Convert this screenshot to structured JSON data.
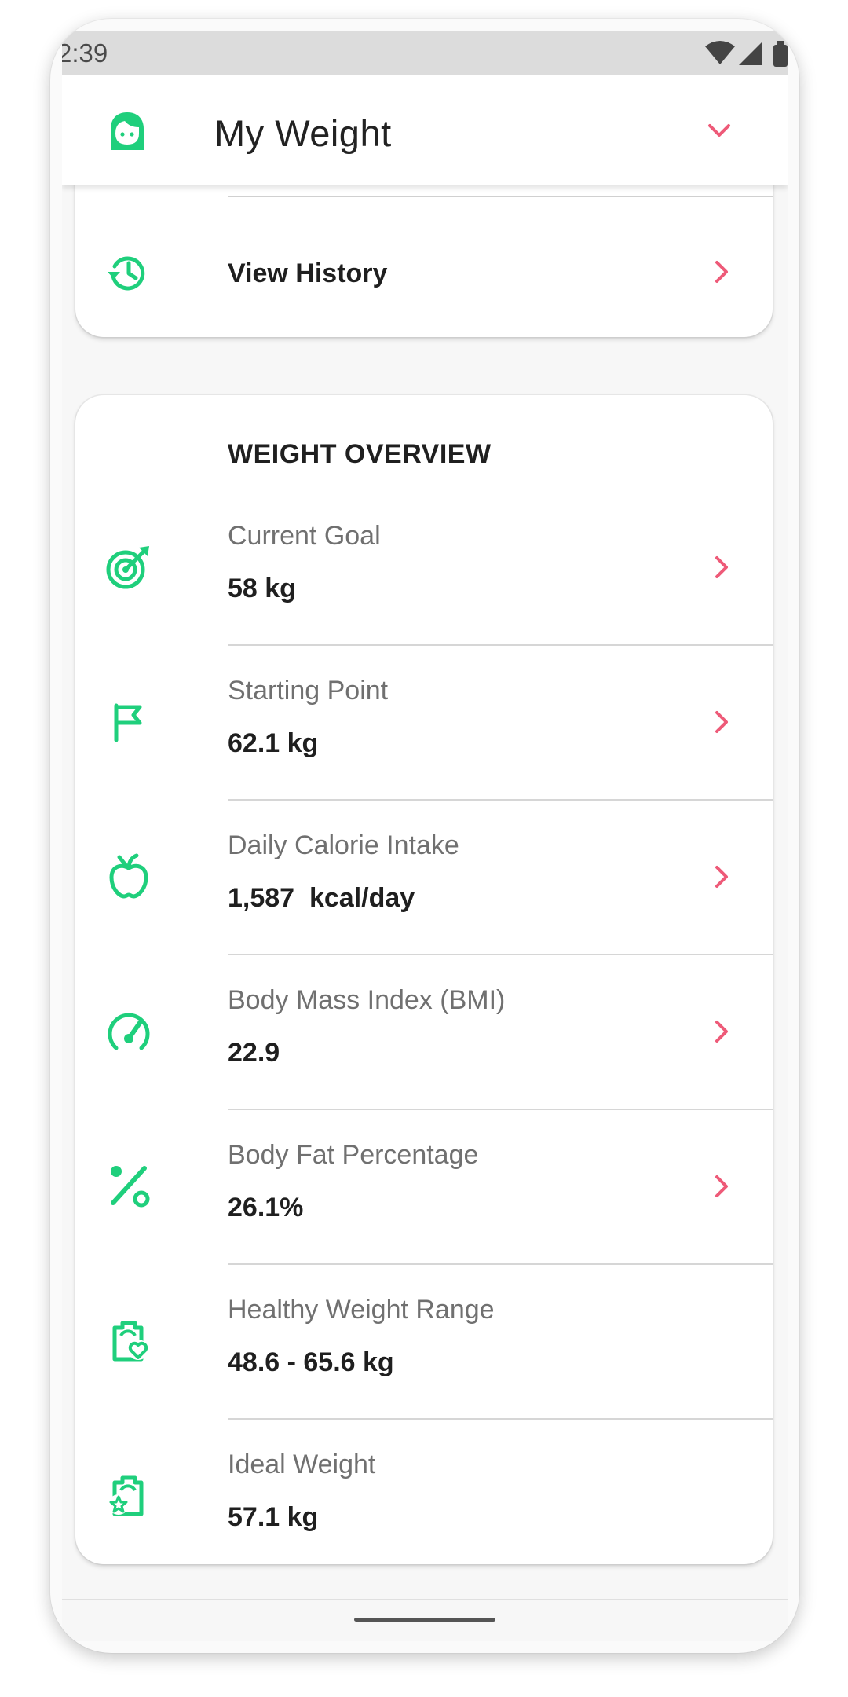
{
  "status_bar": {
    "time": "2:39"
  },
  "app_bar": {
    "title": "My Weight",
    "avatar_icon": "face-avatar-icon",
    "menu_icon": "chevron-down-icon"
  },
  "history": {
    "label": "View History",
    "icon": "history-icon"
  },
  "overview": {
    "title": "WEIGHT OVERVIEW",
    "rows": [
      {
        "label": "Current Goal",
        "value": "58 kg",
        "icon": "target-icon",
        "has_chevron": true
      },
      {
        "label": "Starting Point",
        "value": "62.1 kg",
        "icon": "flag-icon",
        "has_chevron": true
      },
      {
        "label": "Daily Calorie Intake",
        "value": "1,587  kcal/day",
        "icon": "apple-icon",
        "has_chevron": true
      },
      {
        "label": "Body Mass Index (BMI)",
        "value": "22.9",
        "icon": "gauge-icon",
        "has_chevron": true
      },
      {
        "label": "Body Fat Percentage",
        "value": "26.1%",
        "icon": "percent-icon",
        "has_chevron": true
      },
      {
        "label": "Healthy Weight Range",
        "value": "48.6 - 65.6 kg",
        "icon": "scale-heart-icon",
        "has_chevron": false
      },
      {
        "label": "Ideal Weight",
        "value": "57.1 kg",
        "icon": "scale-star-icon",
        "has_chevron": false
      }
    ]
  },
  "colors": {
    "accent_green": "#1fcf7c",
    "chevron_pink": "#ee5a78",
    "text_dark": "#1f1f1f",
    "text_muted": "#707070"
  }
}
